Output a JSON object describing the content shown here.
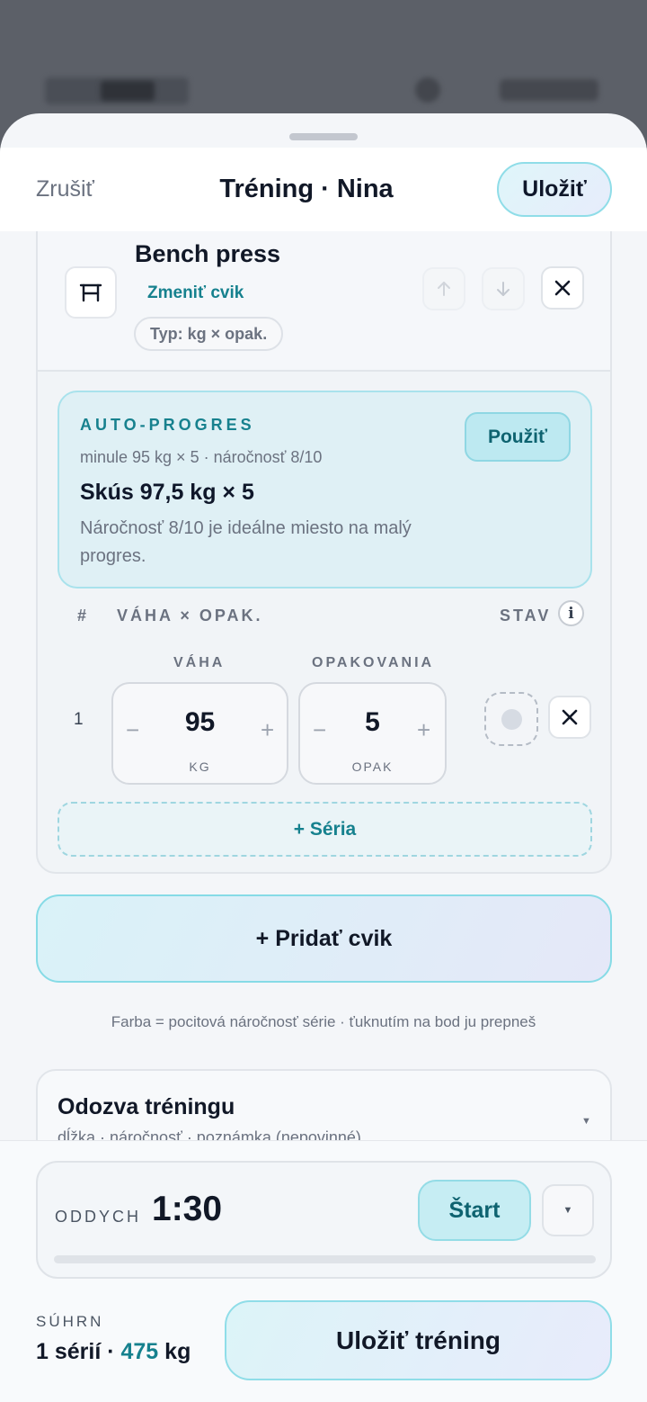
{
  "header": {
    "cancel_label": "Zrušiť",
    "title": "Tréning · Nina",
    "save_label": "Uložiť"
  },
  "exercise": {
    "name": "Bench press",
    "change_label": "Zmeniť cvik",
    "type_label": "Typ: kg × opak.",
    "icon": "bench-icon"
  },
  "auto_progress": {
    "label": "AUTO-PROGRES",
    "last": "minule 95 kg × 5 · náročnosť 8/10",
    "suggestion": "Skús 97,5 kg × 5",
    "note": "Náročnosť 8/10 je ideálne miesto na malý progres.",
    "apply_label": "Použiť"
  },
  "sets_table": {
    "col_number": "#",
    "col_weight_reps": "VÁHA × OPAK.",
    "col_status": "STAV",
    "info_glyph": "i",
    "weight_header": "VÁHA",
    "reps_header": "OPAKOVANIA",
    "rows": [
      {
        "number": "1",
        "weight": "95",
        "weight_unit": "KG",
        "reps": "5",
        "reps_unit": "OPAK"
      }
    ],
    "add_set_label": "+ Séria"
  },
  "add_exercise_label": "+ Pridať cvik",
  "legend": "Farba = pocitová náročnosť série · ťuknutím na bod ju prepneš",
  "feedback": {
    "title": "Odozva tréningu",
    "subtitle": "dĺžka · náročnosť · poznámka (nepovinné)"
  },
  "rest_timer": {
    "label": "ODDYCH",
    "value": "1:30",
    "start_label": "Štart",
    "progress": 0
  },
  "summary": {
    "label": "SÚHRN",
    "sets_text": "1 sérií · ",
    "weight_value": "475",
    "weight_unit": " kg",
    "save_label": "Uložiť tréning"
  },
  "colors": {
    "accent": "#16818e",
    "accent_border": "#8fdde8",
    "background": "#f4f6f9"
  }
}
